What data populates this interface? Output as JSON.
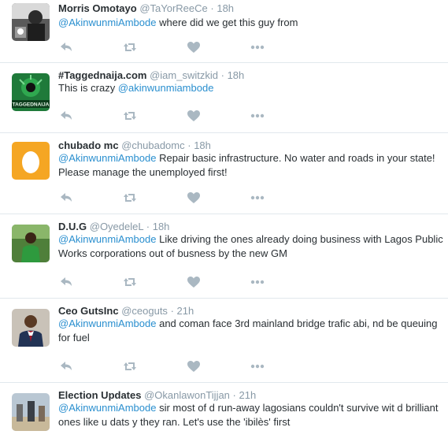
{
  "tweets": [
    {
      "name": "Morris Omotayo",
      "handle": "@TaYorReeCe",
      "sep": "·",
      "time": "18h",
      "mention": "@AkinwunmiAmbode",
      "text": " where did we get this guy from",
      "avatar_icon": "profile-photo"
    },
    {
      "name": "#Taggednaija.com",
      "handle": "@iam_switzkid",
      "sep": "·",
      "time": "18h",
      "prefix": "This is crazy ",
      "mention": "@akinwunmiambode",
      "text": "",
      "avatar_icon": "taggednaija-logo",
      "avatar_text": "TAGGEDNAIJA"
    },
    {
      "name": "chubado mc",
      "handle": "@chubadomc",
      "sep": "·",
      "time": "18h",
      "mention": "@AkinwunmiAmbode",
      "text": " Repair basic infrastructure. No water and roads in your state! Please manage the unemployed first!",
      "avatar_icon": "default-egg-avatar"
    },
    {
      "name": "D.U.G",
      "handle": "@OyedeleL",
      "sep": "·",
      "time": "18h",
      "mention": "@AkinwunmiAmbode",
      "text": " Like driving the ones already doing business with  Lagos Public Works corporations out of busness by the new GM",
      "avatar_icon": "profile-photo"
    },
    {
      "name": "Ceo GutsInc",
      "handle": "@ceoguts",
      "sep": "·",
      "time": "21h",
      "mention": "@AkinwunmiAmbode",
      "text": " and coman face 3rd mainland bridge trafic abi, nd be queuing for fuel",
      "avatar_icon": "profile-photo"
    },
    {
      "name": "Election Updates",
      "handle": "@OkanlawonTijjan",
      "sep": "·",
      "time": "21h",
      "mention": "@AkinwunmiAmbode",
      "text": " sir most of d run-away lagosians couldn't survive wit d brilliant ones like u dats y they ran. Let's use the 'ibilès' first",
      "avatar_icon": "profile-photo"
    }
  ],
  "colors": {
    "link": "#2a8fcf",
    "name": "#292f33",
    "meta": "#8899a6",
    "action_icon": "#aab8c2",
    "divider": "#e1e8ed",
    "egg_bg": "#f5a623"
  },
  "action_icons": [
    "reply-icon",
    "retweet-icon",
    "like-icon",
    "more-icon"
  ]
}
